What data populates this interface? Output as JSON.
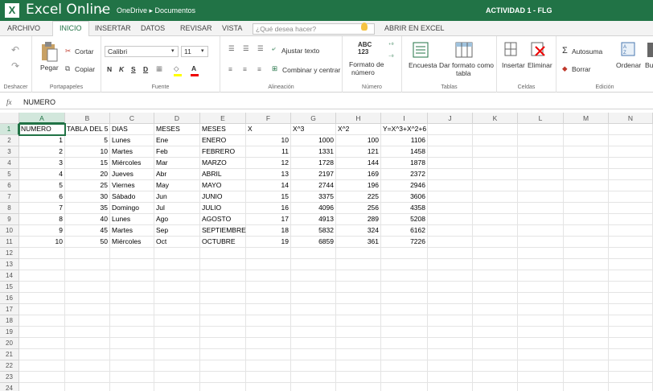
{
  "titlebar": {
    "app": "Excel Online",
    "breadcrumb": "OneDrive ▸ Documentos",
    "doc": "ACTIVIDAD 1 - FLG",
    "logo": "X"
  },
  "tabs": [
    "ARCHIVO",
    "INICIO",
    "INSERTAR",
    "DATOS",
    "REVISAR",
    "VISTA"
  ],
  "tellme": "¿Qué desea hacer?",
  "open_in_excel": "ABRIR EN EXCEL",
  "ribbon": {
    "undo_group": "Deshacer",
    "clipboard": {
      "paste": "Pegar",
      "cut": "Cortar",
      "copy": "Copiar",
      "label": "Portapapeles"
    },
    "font": {
      "name": "Calibri",
      "size": "11",
      "bold": "N",
      "italic": "K",
      "underline": "S",
      "strike": "D",
      "label": "Fuente"
    },
    "alignment": {
      "wrap": "Ajustar texto",
      "merge": "Combinar y centrar",
      "label": "Alineación"
    },
    "number": {
      "abc": "ABC",
      "n123": "123",
      "format": "Formato de",
      "format2": "número",
      "label": "Número"
    },
    "tables": {
      "survey": "Encuesta",
      "format_table": "Dar formato como",
      "format_table2": "tabla",
      "label": "Tablas"
    },
    "cells": {
      "insert": "Insertar",
      "delete": "Eliminar",
      "label": "Celdas"
    },
    "editing": {
      "autosum": "Autosuma",
      "clear": "Borrar",
      "sort": "Ordenar",
      "find": "Bu",
      "label": "Edición"
    }
  },
  "formula": {
    "fx": "fx",
    "value": "NUMERO"
  },
  "columns": [
    "A",
    "B",
    "C",
    "D",
    "E",
    "F",
    "G",
    "H",
    "I",
    "J",
    "K",
    "L",
    "M",
    "N"
  ],
  "rows": [
    "1",
    "2",
    "3",
    "4",
    "5",
    "6",
    "7",
    "8",
    "9",
    "10",
    "11",
    "12",
    "13",
    "14",
    "15",
    "16",
    "17",
    "18",
    "19",
    "20",
    "21",
    "22",
    "23",
    "24"
  ],
  "sheet": [
    [
      "NUMERO",
      "TABLA DEL 5",
      "DIAS",
      "MESES",
      "MESES",
      "X",
      "X^3",
      "X^2",
      "Y=X^3+X^2+6"
    ],
    [
      "1",
      "5",
      "Lunes",
      "Ene",
      "ENERO",
      "10",
      "1000",
      "100",
      "1106"
    ],
    [
      "2",
      "10",
      "Martes",
      "Feb",
      "FEBRERO",
      "11",
      "1331",
      "121",
      "1458"
    ],
    [
      "3",
      "15",
      "Miércoles",
      "Mar",
      "MARZO",
      "12",
      "1728",
      "144",
      "1878"
    ],
    [
      "4",
      "20",
      "Jueves",
      "Abr",
      "ABRIL",
      "13",
      "2197",
      "169",
      "2372"
    ],
    [
      "5",
      "25",
      "Viernes",
      "May",
      "MAYO",
      "14",
      "2744",
      "196",
      "2946"
    ],
    [
      "6",
      "30",
      "Sábado",
      "Jun",
      "JUNIO",
      "15",
      "3375",
      "225",
      "3606"
    ],
    [
      "7",
      "35",
      "Domingo",
      "Jul",
      "JULIO",
      "16",
      "4096",
      "256",
      "4358"
    ],
    [
      "8",
      "40",
      "Lunes",
      "Ago",
      "AGOSTO",
      "17",
      "4913",
      "289",
      "5208"
    ],
    [
      "9",
      "45",
      "Martes",
      "Sep",
      "SEPTIEMBRE",
      "18",
      "5832",
      "324",
      "6162"
    ],
    [
      "10",
      "50",
      "Miércoles",
      "Oct",
      "OCTUBRE",
      "19",
      "6859",
      "361",
      "7226"
    ]
  ],
  "colors": {
    "brand": "#217346"
  }
}
